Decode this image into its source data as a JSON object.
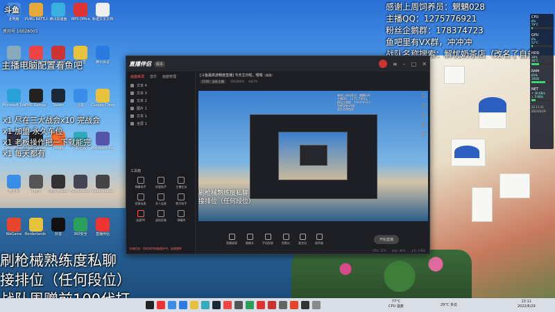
{
  "overlay": {
    "top_right_lines": [
      "感谢上周饲养员：魍魉028",
      "主播QQ：1275776921",
      "粉丝企鹅群：178374723",
      "鱼吧里有VX群，冲冲冲",
      "战队名称搜索：解忧奶茶店（改名了自备）"
    ],
    "left_mid": "主播电脑配置看鱼吧",
    "queue_lines": [
      "x1 尽在三大战会x10 完战会",
      "x1 加盟·永久车位",
      "x1 老板操作把一下就能完",
      "x1 每天都有"
    ],
    "big_lines": [
      "刷枪械熟练度私聊",
      "接排位（任何段位）",
      "战队周赠前100代打"
    ]
  },
  "desktop": {
    "brand_logo": "斗鱼",
    "room_id": "房间号 10028005",
    "icons": [
      {
        "label": "此电脑",
        "color": "#4b8ee8"
      },
      {
        "label": "PUBG BATTLEGR...",
        "color": "#e6a83a"
      },
      {
        "label": "腾讯加速器",
        "color": "#3ab0e0"
      },
      {
        "label": "WPS Office",
        "color": "#d33"
      },
      {
        "label": "新建文本文档",
        "color": "#eee"
      },
      {
        "label": "回收站",
        "color": "#8ab"
      },
      {
        "label": "网易UU加速器",
        "color": "#e44"
      },
      {
        "label": "Apex Legends",
        "color": "#c33"
      },
      {
        "label": "YY语音",
        "color": "#e8c23a"
      },
      {
        "label": "腾讯会议",
        "color": "#2a7be0"
      },
      {
        "label": "Microsoft Edge",
        "color": "#2aa0d8"
      },
      {
        "label": "EPIC Games Launcher",
        "color": "#222"
      },
      {
        "label": "Steam",
        "color": "#1b2838"
      },
      {
        "label": "迅雷",
        "color": "#3a8ee8"
      },
      {
        "label": "Google Chrome",
        "color": "#e8c23a"
      },
      {
        "label": "Control Center",
        "color": "#334"
      },
      {
        "label": "Epic Games",
        "color": "#222"
      },
      {
        "label": "Origin",
        "color": "#f56c2d"
      },
      {
        "label": "UU远程",
        "color": "#3ab"
      },
      {
        "label": "Microsoft Store",
        "color": "#55a"
      },
      {
        "label": "鲁大师",
        "color": "#3a8ee8"
      },
      {
        "label": "PREY",
        "color": "#555"
      },
      {
        "label": "OBS Studio",
        "color": "#333"
      },
      {
        "label": "NI Multicon",
        "color": "#445"
      },
      {
        "label": "Voicemeeter",
        "color": "#444"
      },
      {
        "label": "WeGame",
        "color": "#e8452d"
      },
      {
        "label": "Borderlands 3",
        "color": "#e8c23a"
      },
      {
        "label": "抖音",
        "color": "#111"
      },
      {
        "label": "360安全",
        "color": "#2aa05a"
      },
      {
        "label": "直播伴侣",
        "color": "#e33"
      }
    ]
  },
  "app": {
    "logo": "直播伴侣",
    "version": "版本",
    "side_tabs": [
      "画面来源",
      "音乐",
      "画面管理"
    ],
    "sources": [
      "文本 4",
      "文本 3",
      "文本 2",
      "图片 1",
      "文本 1",
      "全屏 1"
    ],
    "tools_header": "工具箱",
    "tools": [
      "弹幕助手",
      "房管助手",
      "主播任务",
      "投屏连麦",
      "多人连麦",
      "数字助手",
      "连麦PK",
      "虚拟形象",
      "弹幕库"
    ],
    "side_foot": "礼物任务：你的实时电脑保护中，加速哪种",
    "room_title": "[斗鱼最高流畅度直播] 今天主日啦，嘿嘿",
    "room_tag": "修改",
    "room_meta": [
      "CF4D · 全网·主播",
      "10028005",
      "44176"
    ],
    "controls": [
      "直播录屏",
      "摄像头",
      "手机投屏",
      "投影仪",
      "麦克风",
      "扬声器"
    ],
    "start_button": "开始直播",
    "status": [
      "CPU: 11%",
      "内存: 46%",
      "上行: 0 B/s"
    ]
  },
  "preview_text": {
    "lines": [
      "感谢上周饲养员：魍魉028",
      "主播QQ：1275776921",
      "粉丝企鹅群：178374723",
      "鱼吧里有VX群",
      "战队名称搜索"
    ],
    "big": [
      "刷枪械熟练度私聊",
      "接排位（任何段位）"
    ]
  },
  "monitor": {
    "items": [
      {
        "label": "CPU",
        "value": "8%",
        "sub": "79°C",
        "level": 0.08
      },
      {
        "label": "GPU",
        "value": "6%",
        "sub": "52°C",
        "level": 0.06
      },
      {
        "label": "HDD",
        "value": "38%",
        "sub": "36°C",
        "level": 0.38
      },
      {
        "label": "RAM",
        "value": "65%",
        "sub": "16GB",
        "level": 0.65
      },
      {
        "label": "NET",
        "value": "↑ 30 KB/s",
        "sub": "↓ 5 KB/s",
        "level": 0.2
      }
    ],
    "time": "22:11:31",
    "date": "2022/6/29"
  },
  "taskbar": {
    "weather_temp": "77°C",
    "weather_label": "CPU 温度",
    "weather2": "29°C 多云",
    "time": "22:11",
    "date": "2022/6/29",
    "icon_colors": [
      "#222",
      "#e33",
      "#3a8ee8",
      "#2a7be0",
      "#e8c23a",
      "#3ab",
      "#1b2838",
      "#e44",
      "#555",
      "#2aa05a",
      "#d33",
      "#c33",
      "#666",
      "#e8452d",
      "#333",
      "#888"
    ]
  },
  "colors": {
    "accent": "#ff5a5a",
    "window_bg": "#1e1f24",
    "taskbar": "#d9dde6"
  }
}
